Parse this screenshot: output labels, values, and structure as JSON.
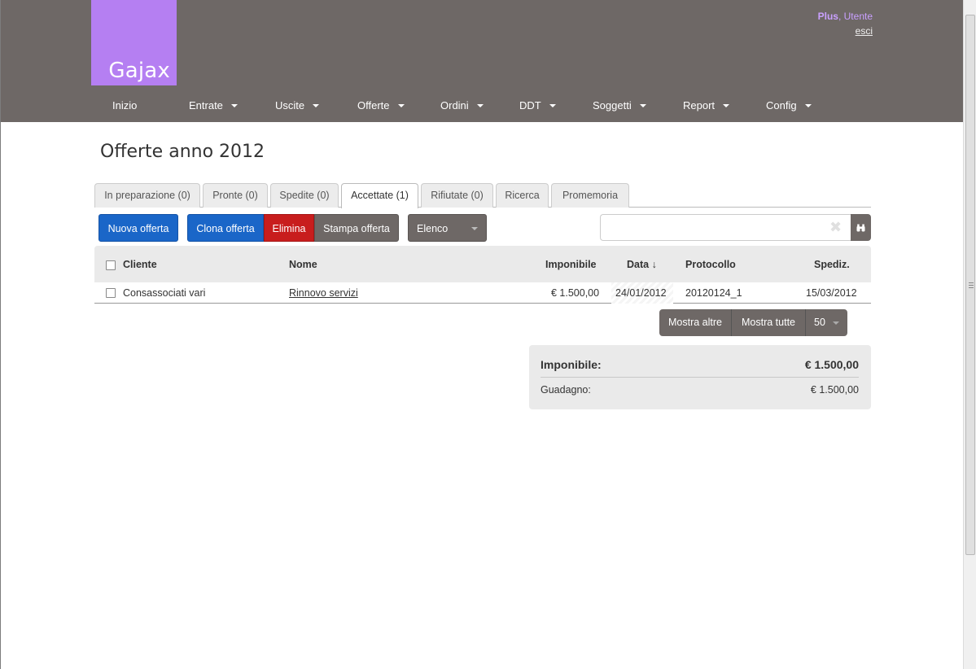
{
  "app": {
    "logo_text": "Gajax"
  },
  "user": {
    "plan": "Plus",
    "separator": ",",
    "name": "Utente",
    "logout_label": "esci"
  },
  "nav": [
    {
      "label": "Inizio",
      "has_dropdown": false
    },
    {
      "label": "Entrate",
      "has_dropdown": true
    },
    {
      "label": "Uscite",
      "has_dropdown": true
    },
    {
      "label": "Offerte",
      "has_dropdown": true
    },
    {
      "label": "Ordini",
      "has_dropdown": true
    },
    {
      "label": "DDT",
      "has_dropdown": true
    },
    {
      "label": "Soggetti",
      "has_dropdown": true
    },
    {
      "label": "Report",
      "has_dropdown": true
    },
    {
      "label": "Config",
      "has_dropdown": true
    }
  ],
  "page": {
    "title": "Offerte anno 2012"
  },
  "tabs": [
    {
      "label": "In preparazione (0)",
      "active": false
    },
    {
      "label": "Pronte (0)",
      "active": false
    },
    {
      "label": "Spedite (0)",
      "active": false
    },
    {
      "label": "Accettate (1)",
      "active": true
    },
    {
      "label": "Rifiutate (0)",
      "active": false
    },
    {
      "label": "Ricerca",
      "active": false
    },
    {
      "label": "Promemoria",
      "active": false
    }
  ],
  "toolbar": {
    "new_label": "Nuova offerta",
    "clone_label": "Clona offerta",
    "delete_label": "Elimina",
    "print_label": "Stampa offerta",
    "view_select": "Elenco"
  },
  "search": {
    "value": "",
    "clear_glyph": "✖",
    "button_icon": "binoculars-icon"
  },
  "table": {
    "headers": {
      "cliente": "Cliente",
      "nome": "Nome",
      "imponibile": "Imponibile",
      "data": "Data ↓",
      "protocollo": "Protocollo",
      "spediz": "Spediz."
    },
    "rows": [
      {
        "cliente": "Consassociati vari",
        "nome": "Rinnovo servizi",
        "imponibile": "€ 1.500,00",
        "data": "24/01/2012",
        "protocollo": "20120124_1",
        "spediz": "15/03/2012"
      }
    ]
  },
  "pager": {
    "more_label": "Mostra altre",
    "all_label": "Mostra tutte",
    "page_size": "50"
  },
  "summary": {
    "imponibile_label": "Imponibile:",
    "imponibile_value": "€ 1.500,00",
    "guadagno_label": "Guadagno:",
    "guadagno_value": "€ 1.500,00"
  },
  "colors": {
    "header_bg": "#6e6866",
    "logo_bg": "#b57ff2",
    "primary_blue": "#1a66c8",
    "danger_red": "#c81d1d",
    "user_accent": "#c9a0ff"
  }
}
